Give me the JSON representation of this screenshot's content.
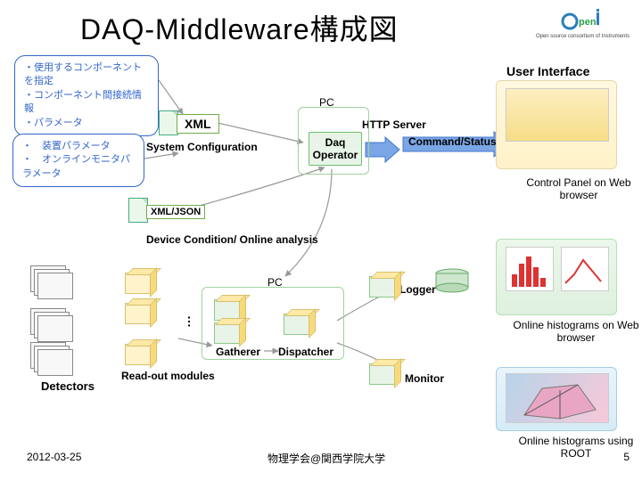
{
  "title": "DAQ-Middleware構成図",
  "logo": {
    "brand": "Open-It",
    "tagline": "Open source consortium of Instruments"
  },
  "callouts": {
    "spec": "・使用するコンポーネントを指定\n・コンポーネント間接続情報\n・パラメータ",
    "params": "・　装置パラメータ\n・　オンラインモニタパラメータ"
  },
  "labels": {
    "xml": "XML",
    "xmljson": "XML/JSON",
    "sysconf": "System Configuration",
    "pc": "PC",
    "daqop": "Daq Operator",
    "httpserver": "HTTP Server",
    "cmdstatus": "Command/Status",
    "ui": "User Interface",
    "ctrlpanel": "Control Panel on Web browser",
    "devcond": "Device Condition/ Online analysis",
    "logger": "Logger",
    "olhist_web": "Online histograms on Web browser",
    "olhist_root": "Online histograms using ROOT",
    "gatherer": "Gatherer",
    "dispatcher": "Dispatcher",
    "monitor": "Monitor",
    "readout": "Read-out modules",
    "detectors": "Detectors",
    "vdots": "…"
  },
  "footer": {
    "date": "2012-03-25",
    "venue": "物理学会@関西学院大学",
    "page": "5"
  }
}
